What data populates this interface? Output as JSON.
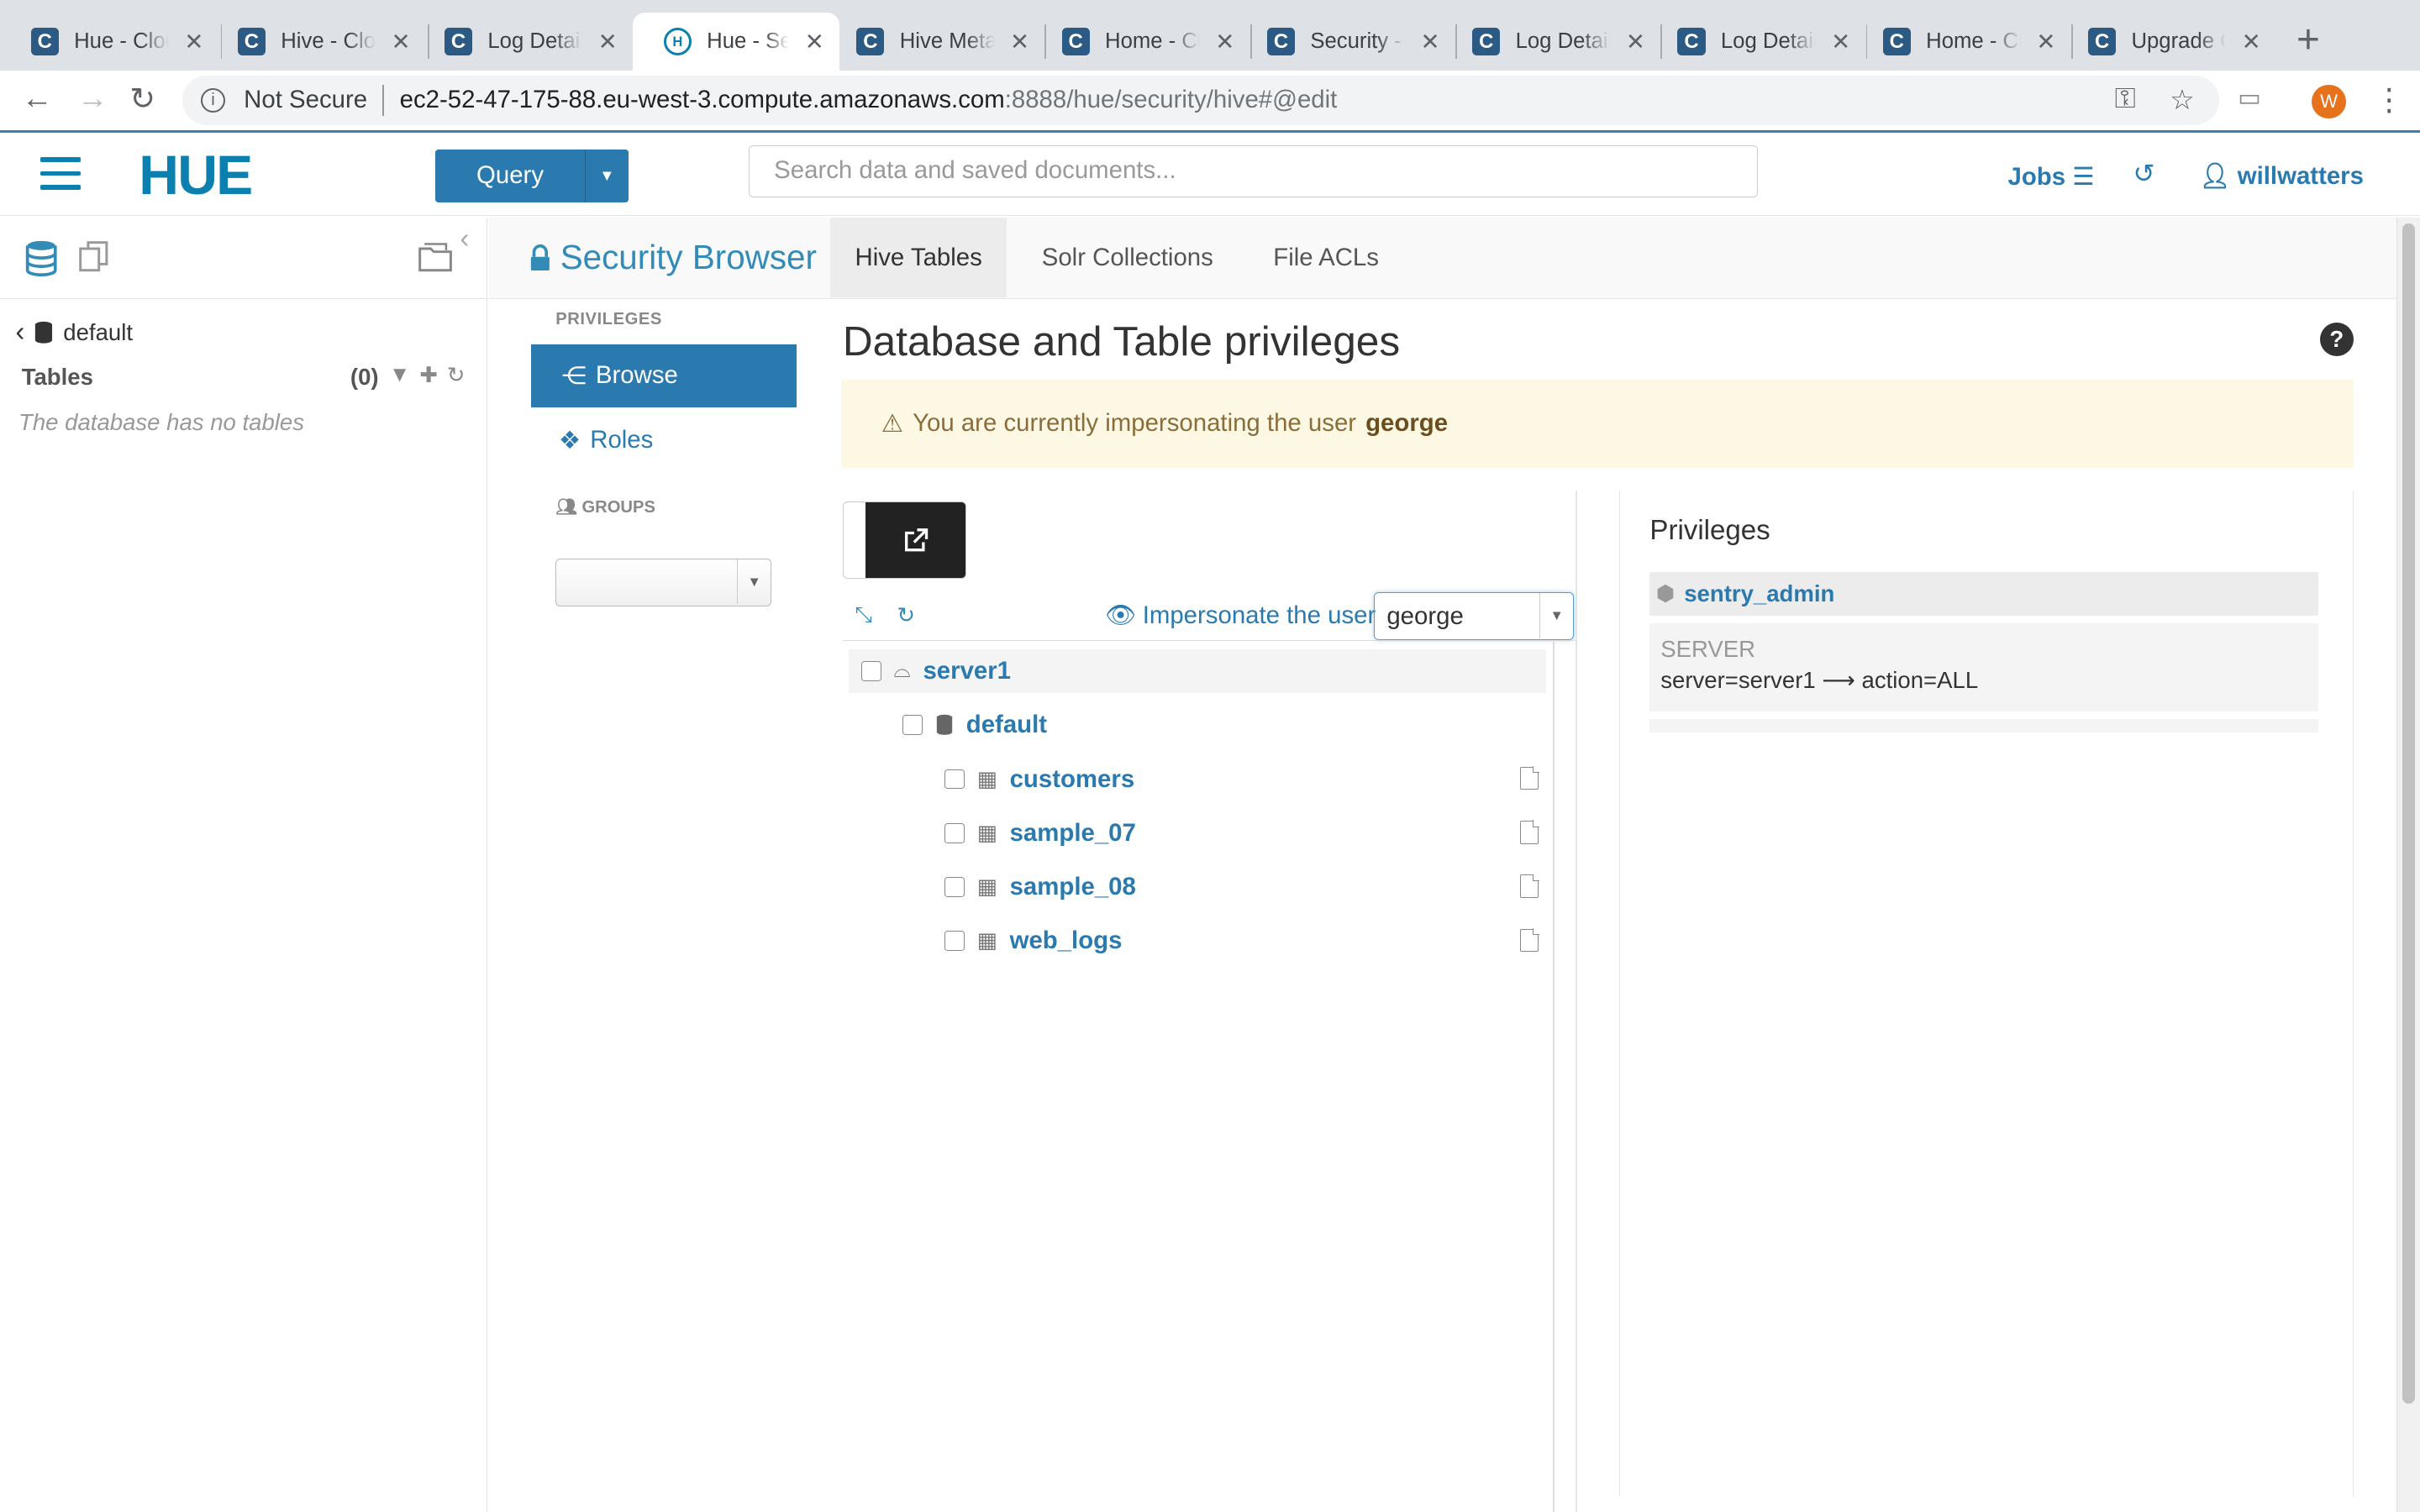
{
  "browser": {
    "tabs": [
      {
        "title": "Hue - Cloudera",
        "fav": "C",
        "active": false
      },
      {
        "title": "Hive - Cloudera",
        "fav": "C",
        "active": false
      },
      {
        "title": "Log Details",
        "fav": "C",
        "active": false
      },
      {
        "title": "Hue - Security",
        "fav": "H",
        "active": true
      },
      {
        "title": "Hive Metastore",
        "fav": "C",
        "active": false
      },
      {
        "title": "Home - Cloudera",
        "fav": "C",
        "active": false
      },
      {
        "title": "Security - Cloudera",
        "fav": "C",
        "active": false
      },
      {
        "title": "Log Details",
        "fav": "C",
        "active": false
      },
      {
        "title": "Log Details",
        "fav": "C",
        "active": false
      },
      {
        "title": "Home - Cloudera",
        "fav": "C",
        "active": false
      },
      {
        "title": "Upgrade Cloudera",
        "fav": "C",
        "active": false
      }
    ],
    "security_label": "Not Secure",
    "url_host": "ec2-52-47-175-88.eu-west-3.compute.amazonaws.com",
    "url_path": ":8888/hue/security/hive#@edit",
    "profile_initial": "W"
  },
  "hue": {
    "logo": "HUE",
    "query_label": "Query",
    "search_placeholder": "Search data and saved documents...",
    "jobs_label": "Jobs",
    "username": "willwatters"
  },
  "assist": {
    "database": "default",
    "tables_label": "Tables",
    "tables_count": "(0)",
    "empty_message": "The database has no tables"
  },
  "security": {
    "title": "Security Browser",
    "tabs": [
      "Hive Tables",
      "Solr Collections",
      "File ACLs"
    ],
    "privileges_heading": "PRIVILEGES",
    "nav_browse": "Browse",
    "nav_roles": "Roles",
    "groups_heading": "GROUPS",
    "page_title": "Database and Table privileges",
    "alert_prefix": "You are currently impersonating the user",
    "alert_user": "george",
    "impersonate_label": "Impersonate the user",
    "impersonate_value": "george"
  },
  "tree": {
    "server": "server1",
    "database": "default",
    "tables": [
      "customers",
      "sample_07",
      "sample_08",
      "web_logs"
    ]
  },
  "privileges": {
    "title": "Privileges",
    "role": "sentry_admin",
    "level": "SERVER",
    "action": "server=server1 ⟶ action=ALL"
  }
}
